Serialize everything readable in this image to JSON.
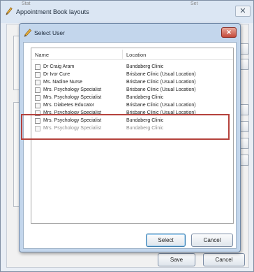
{
  "background_window": {
    "title": "Appointment Book layouts",
    "partial_tabs": [
      "Stat",
      "Set"
    ],
    "close_glyph": "✕",
    "save_label": "Save",
    "cancel_label": "Cancel",
    "app_icon": "pencil-icon"
  },
  "dialog": {
    "title": "Select User",
    "icon": "select-user-icon",
    "close_glyph": "✕",
    "columns": {
      "name": "Name",
      "location": "Location"
    },
    "rows": [
      {
        "name": "Dr Craig Aram",
        "location": "Bundaberg Clinic"
      },
      {
        "name": "Dr Ivor Cure",
        "location": "Brisbane Clinic (Usual Location)"
      },
      {
        "name": "Ms. Nadine Nurse",
        "location": "Brisbane Clinic (Usual Location)"
      },
      {
        "name": "Mrs. Psychology Specialist",
        "location": "Brisbane Clinic (Usual Location)"
      },
      {
        "name": "Mrs. Psychology Specialist",
        "location": "Bundaberg Clinic"
      },
      {
        "name": "Mrs. Diabetes Educator",
        "location": "Brisbane Clinic (Usual Location)"
      },
      {
        "name": "Mrs. Psychology Specialist",
        "location": "Brisbane Clinic (Usual Location)"
      },
      {
        "name": "Mrs. Psychology Specialist",
        "location": "Bundaberg Clinic"
      },
      {
        "name": "Mrs. Psychology Specialist",
        "location": "Bundaberg Clinic"
      }
    ],
    "select_label": "Select",
    "cancel_label": "Cancel"
  },
  "colors": {
    "dialog_frame": "#c3d6ec",
    "close_button": "#c4493a",
    "highlight_box": "#b5423c"
  }
}
